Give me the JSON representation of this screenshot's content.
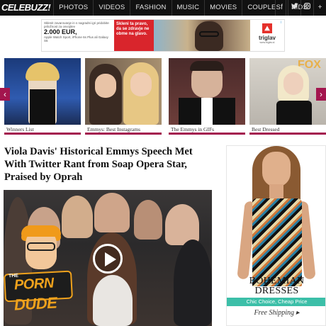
{
  "navbar": {
    "logo": "CELEBUZZ!",
    "links": [
      "PHOTOS",
      "VIDEOS",
      "FASHION",
      "MUSIC",
      "MOVIES",
      "COUPLES",
      "KIDS"
    ],
    "icons": [
      {
        "name": "facebook-icon",
        "glyph": "f"
      },
      {
        "name": "twitter-icon",
        "glyph": "🐦"
      },
      {
        "name": "instagram-icon",
        "glyph": "◘"
      },
      {
        "name": "plus-icon",
        "glyph": "+"
      }
    ]
  },
  "top_ad": {
    "small_text": "Sklenit zavarovanje in s nagradni igri pridobite priložnost za osvojitev",
    "amount": "2.000 EUR,",
    "prize": "Apple Watch Sport, iPhone 6s Plus ali Galaxy S6",
    "red_text": "Skleni ta pravo, da se zdravje ne obme na glavo.",
    "brand": "triglav",
    "brand_url": "www.triglav.si",
    "info_glyph": "i"
  },
  "slider": {
    "prev_glyph": "‹",
    "next_glyph": "›",
    "slides": [
      {
        "caption": "Winners List"
      },
      {
        "caption": "Emmys: Best Instagrams"
      },
      {
        "caption": "The Emmys in GIFs"
      },
      {
        "caption": "Best Dressed"
      }
    ]
  },
  "article": {
    "title": "Viola Davis' Historical Emmys Speech Met With Twitter Rant from Soap Opera Star, Praised by Oprah"
  },
  "video": {
    "play_icon": "play-icon"
  },
  "sticker": {
    "the": "THE",
    "line1": "PORN",
    "line2": "DUDE"
  },
  "side_ad": {
    "headline": "BOHEMIAN DRESSES",
    "sub": "Chic Choice, Cheap Price",
    "shipping": "Free Shipping ▸"
  },
  "colors": {
    "accent": "#a3154e",
    "navbar": "#111111",
    "teal": "#3cbfa8"
  }
}
